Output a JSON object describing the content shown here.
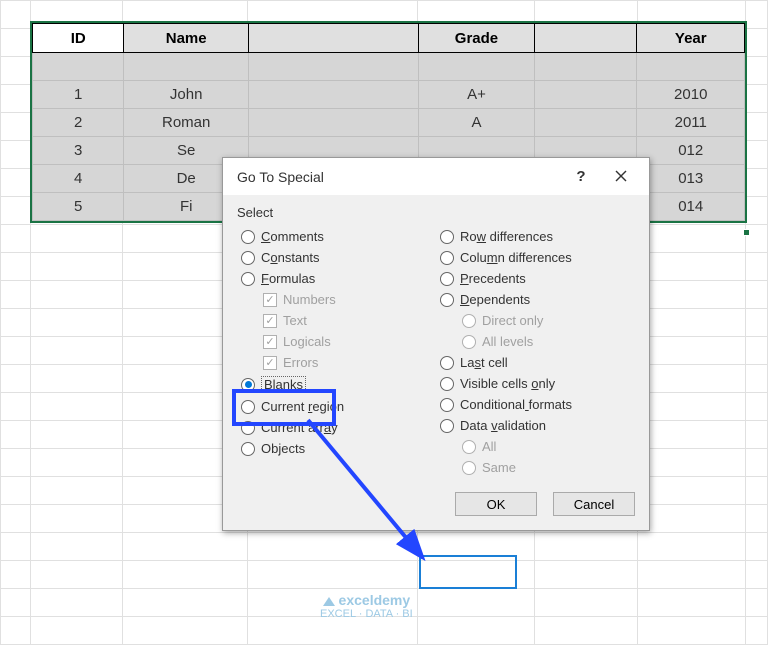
{
  "table": {
    "headers": [
      "ID",
      "Name",
      "",
      "Grade",
      "",
      "Year"
    ],
    "rows": [
      {
        "id": "1",
        "name": "John",
        "col3": "",
        "grade": "A+",
        "col5": "",
        "year": "2010"
      },
      {
        "id": "2",
        "name": "Roman",
        "col3": "",
        "grade": "A",
        "col5": "",
        "year": "2011"
      },
      {
        "id": "3",
        "name": "Se",
        "col3": "",
        "grade": "",
        "col5": "",
        "year": "012"
      },
      {
        "id": "4",
        "name": "De",
        "col3": "",
        "grade": "",
        "col5": "",
        "year": "013"
      },
      {
        "id": "5",
        "name": "Fi",
        "col3": "",
        "grade": "",
        "col5": "",
        "year": "014"
      }
    ]
  },
  "dialog": {
    "title": "Go To Special",
    "section": "Select",
    "left": [
      {
        "kind": "radio",
        "label": "Comments",
        "u": 0
      },
      {
        "kind": "radio",
        "label": "Constants",
        "u": 1
      },
      {
        "kind": "radio",
        "label": "Formulas",
        "u": 0
      },
      {
        "kind": "check",
        "label": "Numbers",
        "indent": true,
        "disabled": true,
        "checked": true
      },
      {
        "kind": "check",
        "label": "Text",
        "indent": true,
        "disabled": true,
        "checked": true
      },
      {
        "kind": "check",
        "label": "Logicals",
        "indent": true,
        "disabled": true,
        "checked": true
      },
      {
        "kind": "check",
        "label": "Errors",
        "indent": true,
        "disabled": true,
        "checked": true
      },
      {
        "kind": "radio",
        "label": "Blanks",
        "u": 3,
        "checked": true,
        "focus": true
      },
      {
        "kind": "radio",
        "label": "Current region",
        "u": 8
      },
      {
        "kind": "radio",
        "label": "Current array",
        "u": 11
      },
      {
        "kind": "radio",
        "label": "Objects",
        "u": -1
      }
    ],
    "right": [
      {
        "kind": "radio",
        "label": "Row differences",
        "u": 2
      },
      {
        "kind": "radio",
        "label": "Column differences",
        "u": 4
      },
      {
        "kind": "radio",
        "label": "Precedents",
        "u": 0
      },
      {
        "kind": "radio",
        "label": "Dependents",
        "u": 0
      },
      {
        "kind": "radio",
        "label": "Direct only",
        "indent": true,
        "disabled": true
      },
      {
        "kind": "radio",
        "label": "All levels",
        "indent": true,
        "disabled": true
      },
      {
        "kind": "radio",
        "label": "Last cell",
        "u": 2
      },
      {
        "kind": "radio",
        "label": "Visible cells only",
        "u": 14
      },
      {
        "kind": "radio",
        "label": "Conditional formats",
        "u": 11
      },
      {
        "kind": "radio",
        "label": "Data validation",
        "u": 5
      },
      {
        "kind": "radio",
        "label": "All",
        "indent": true,
        "disabled": true
      },
      {
        "kind": "radio",
        "label": "Same",
        "indent": true,
        "disabled": true
      }
    ],
    "ok": "OK",
    "cancel": "Cancel"
  },
  "watermark": {
    "brand": "exceldemy",
    "tag": "EXCEL · DATA · BI"
  }
}
